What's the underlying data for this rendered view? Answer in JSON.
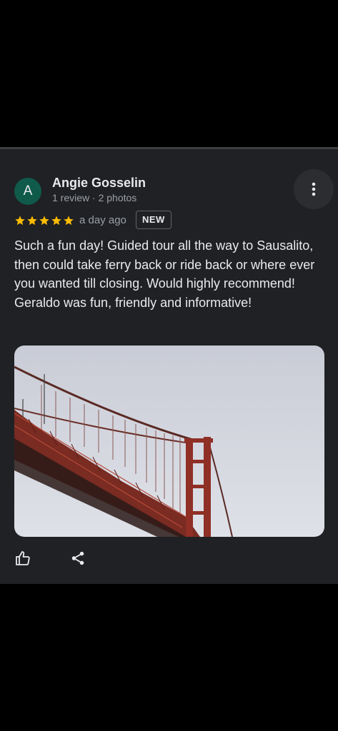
{
  "review": {
    "avatar_letter": "A",
    "author": "Angie Gosselin",
    "author_meta": "1 review · 2 photos",
    "rating": 5,
    "time_ago": "a day ago",
    "badge": "NEW",
    "text": "Such a fun day! Guided tour all the way to Sausalito, then could take ferry back or ride back or where ever you wanted till closing. Would highly recommend! Geraldo was fun, friendly and informative!"
  },
  "colors": {
    "background": "#000000",
    "card": "#202124",
    "star": "#fbbc04",
    "avatar": "#0f5a4a"
  },
  "icons": [
    "more-vert-icon",
    "star-icon",
    "thumbs-up-icon",
    "share-icon"
  ]
}
